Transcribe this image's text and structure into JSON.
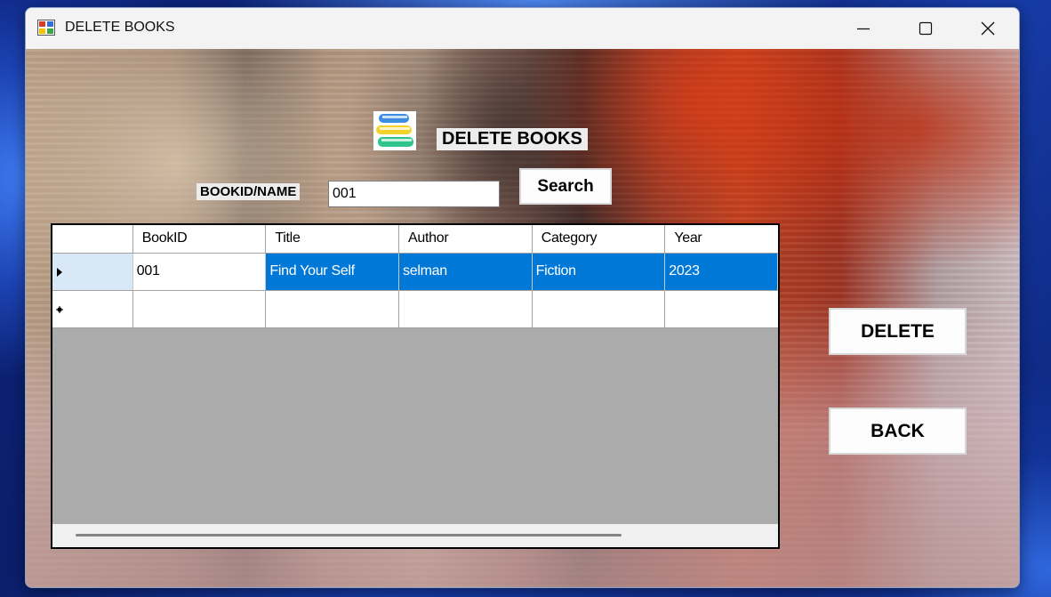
{
  "window": {
    "title": "DELETE BOOKS",
    "controls": [
      "minimize-icon",
      "maximize-icon",
      "close-icon"
    ]
  },
  "form": {
    "heading": "DELETE BOOKS",
    "search_label": "BOOKID/NAME",
    "search_value": "001",
    "search_button": "Search",
    "delete_button": "DELETE",
    "back_button": "BACK"
  },
  "grid": {
    "columns": [
      "BookID",
      "Title",
      "Author",
      "Category",
      "Year"
    ],
    "rows": [
      {
        "BookID": "001",
        "Title": "Find Your Self",
        "Author": "selman",
        "Category": "Fiction",
        "Year": "2023"
      }
    ],
    "current_row_marker": "triangle-right-icon",
    "new_row_marker": "asterisk-icon"
  },
  "colors": {
    "selection": "#0078d7",
    "grid_background": "#ababab"
  }
}
